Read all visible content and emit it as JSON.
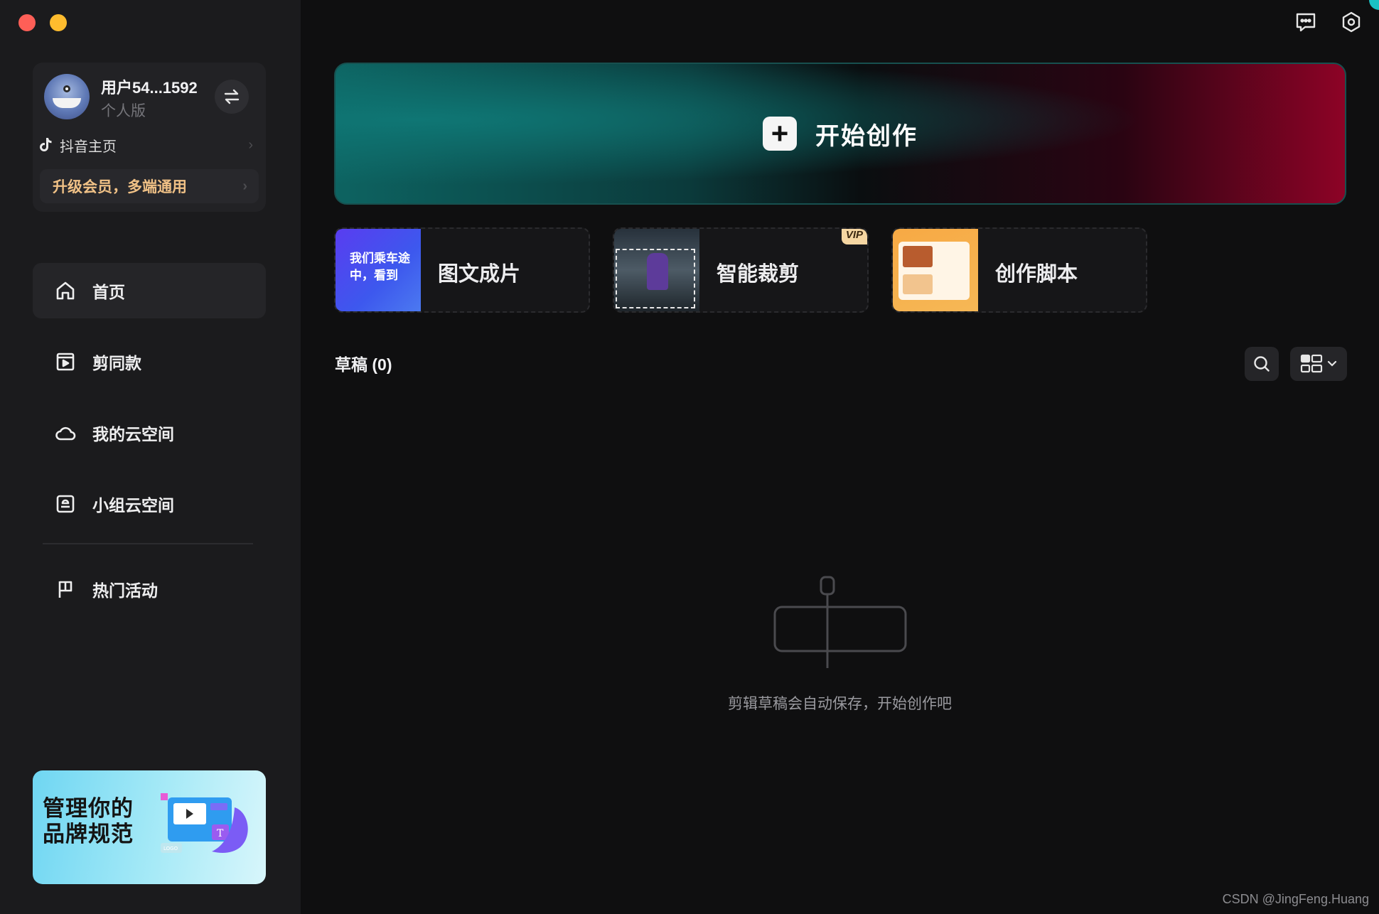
{
  "window": {
    "controls": [
      "close",
      "minimize"
    ]
  },
  "user": {
    "name": "用户54...1592",
    "plan": "个人版",
    "douyin_label": "抖音主页",
    "upgrade_label": "升级会员，多端通用"
  },
  "sidebar": {
    "items": [
      {
        "label": "首页",
        "icon": "home-icon",
        "active": true
      },
      {
        "label": "剪同款",
        "icon": "template-icon"
      },
      {
        "label": "我的云空间",
        "icon": "cloud-icon"
      },
      {
        "label": "小组云空间",
        "icon": "team-cloud-icon"
      },
      {
        "label": "热门活动",
        "icon": "flag-icon"
      }
    ],
    "promo": {
      "text_line1": "管理你的",
      "text_line2": "品牌规范",
      "logo_text": "LOGO"
    }
  },
  "header": {
    "icons": [
      "feedback-icon",
      "settings-icon"
    ]
  },
  "main": {
    "start_label": "开始创作",
    "quick_cards": [
      {
        "label": "图文成片",
        "thumb_text": "我们乘车途中，看到"
      },
      {
        "label": "智能裁剪",
        "badge": "VIP"
      },
      {
        "label": "创作脚本"
      }
    ],
    "drafts_title": "草稿 (0)",
    "empty_text": "剪辑草稿会自动保存，开始创作吧"
  },
  "watermark": "CSDN @JingFeng.Huang",
  "colors": {
    "accent_teal": "#0d6361",
    "accent_red": "#8d0326",
    "upgrade_gold": "#f0c186"
  }
}
